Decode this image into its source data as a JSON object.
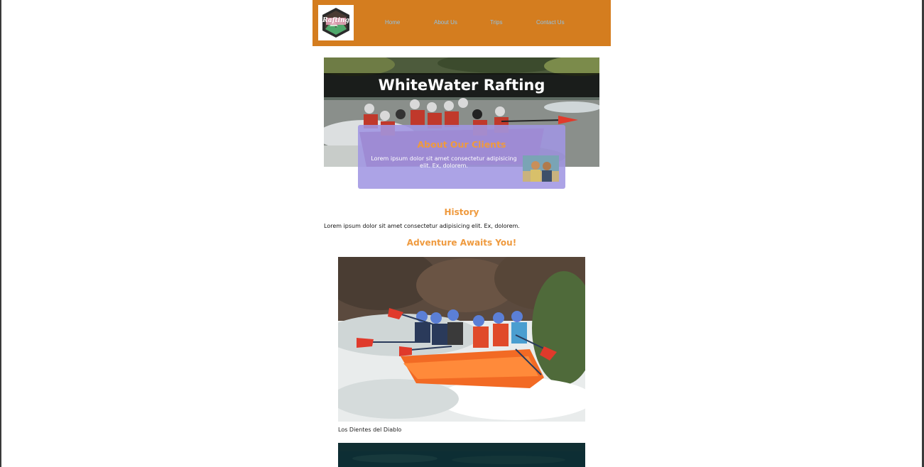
{
  "nav": {
    "logo_text": "Rafting",
    "links": [
      "Home",
      "About Us",
      "Trips",
      "Contact Us"
    ]
  },
  "hero": {
    "title": "WhiteWater Rafting"
  },
  "clients": {
    "title": "About Our Clients",
    "text": "Lorem ipsum dolor sit amet consectetur adipisicing elit. Ex, dolorem."
  },
  "history": {
    "title": "History",
    "text": "Lorem ipsum dolor sit amet consectetur adipisicing elit. Ex, dolorem."
  },
  "adventure": {
    "title": "Adventure Awaits You!",
    "caption": "Los Dientes del Diablo"
  },
  "colors": {
    "navbar": "#d47d1f",
    "nav_link": "#8fc3e8",
    "accent_orange": "#ef9a3e",
    "card_purple": "#a096e2"
  }
}
